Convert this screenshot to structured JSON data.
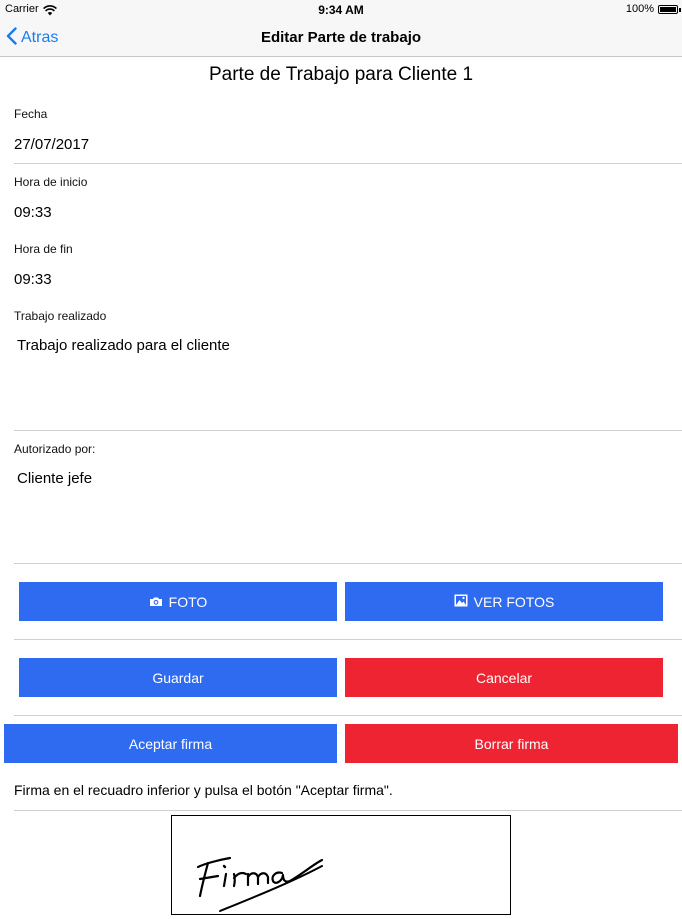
{
  "status_bar": {
    "carrier": "Carrier",
    "time": "9:34 AM",
    "battery": "100%"
  },
  "nav": {
    "back_label": "Atras",
    "title": "Editar Parte de trabajo"
  },
  "form": {
    "heading": "Parte de Trabajo para Cliente 1",
    "fecha_label": "Fecha",
    "fecha_value": "27/07/2017",
    "hora_inicio_label": "Hora de inicio",
    "hora_inicio_value": "09:33",
    "hora_fin_label": "Hora de fin",
    "hora_fin_value": "09:33",
    "trabajo_label": "Trabajo realizado",
    "trabajo_value": "Trabajo realizado para el cliente",
    "autorizado_label": "Autorizado por:",
    "autorizado_value": "Cliente jefe"
  },
  "buttons": {
    "foto": "FOTO",
    "ver_fotos": "VER FOTOS",
    "guardar": "Guardar",
    "cancelar": "Cancelar",
    "aceptar_firma": "Aceptar firma",
    "borrar_firma": "Borrar firma"
  },
  "signature": {
    "instruction": "Firma en el recuadro inferior y pulsa el botón \"Aceptar firma\".",
    "handwritten_text": "Firma"
  },
  "colors": {
    "accent": "#1a7cf5",
    "button_blue": "#2f6bf0",
    "button_red": "#ef2433"
  },
  "icons": {
    "back": "chevron-left-icon",
    "camera": "camera-icon",
    "gallery": "image-icon",
    "wifi": "wifi-icon",
    "battery": "battery-icon"
  }
}
